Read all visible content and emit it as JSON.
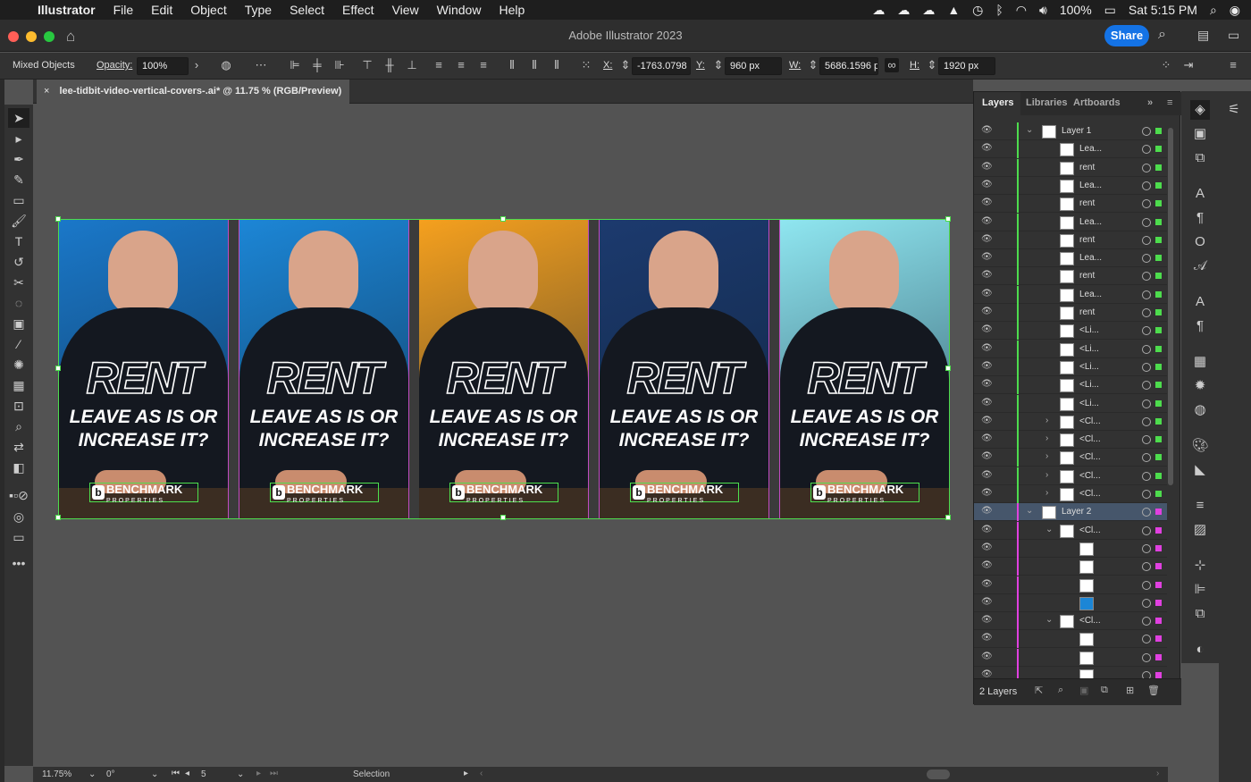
{
  "menubar": {
    "app": "Illustrator",
    "items": [
      "File",
      "Edit",
      "Object",
      "Type",
      "Select",
      "Effect",
      "View",
      "Window",
      "Help"
    ],
    "battery": "100%",
    "clock": "Sat 5:15 PM"
  },
  "window": {
    "title": "Adobe Illustrator 2023",
    "share_label": "Share"
  },
  "control_bar": {
    "selection_type": "Mixed Objects",
    "opacity_label": "Opacity:",
    "opacity_value": "100%",
    "x_label": "X:",
    "x_value": "-1763.0798",
    "y_label": "Y:",
    "y_value": "960 px",
    "w_label": "W:",
    "w_value": "5686.1596 p",
    "h_label": "H:",
    "h_value": "1920 px"
  },
  "document_tab": {
    "label": "lee-tidbit-video-vertical-covers-.ai* @ 11.75 % (RGB/Preview)",
    "close": "×"
  },
  "artboards": {
    "headline": "RENT",
    "subline_1": "LEAVE AS IS OR",
    "subline_2": "INCREASE IT?",
    "brand": "BENCHMARK",
    "brand_sub": "PROPERTIES",
    "brand_mark": "b",
    "backgrounds": [
      "#1a78c9",
      "#1c86d6",
      "#f5a01e",
      "#1c3a6e",
      "#8fe6f0"
    ]
  },
  "layers_panel": {
    "tabs": [
      "Layers",
      "Libraries",
      "Artboards"
    ],
    "rows": [
      {
        "name": "Layer 1",
        "indent": 0,
        "chev": "v",
        "color": "#4ddc4d",
        "layer": true
      },
      {
        "name": "Lea...",
        "indent": 1,
        "chev": "",
        "color": "#4ddc4d"
      },
      {
        "name": "rent",
        "indent": 1,
        "chev": "",
        "color": "#4ddc4d"
      },
      {
        "name": "Lea...",
        "indent": 1,
        "chev": "",
        "color": "#4ddc4d"
      },
      {
        "name": "rent",
        "indent": 1,
        "chev": "",
        "color": "#4ddc4d"
      },
      {
        "name": "Lea...",
        "indent": 1,
        "chev": "",
        "color": "#4ddc4d"
      },
      {
        "name": "rent",
        "indent": 1,
        "chev": "",
        "color": "#4ddc4d"
      },
      {
        "name": "Lea...",
        "indent": 1,
        "chev": "",
        "color": "#4ddc4d"
      },
      {
        "name": "rent",
        "indent": 1,
        "chev": "",
        "color": "#4ddc4d"
      },
      {
        "name": "Lea...",
        "indent": 1,
        "chev": "",
        "color": "#4ddc4d"
      },
      {
        "name": "rent",
        "indent": 1,
        "chev": "",
        "color": "#4ddc4d"
      },
      {
        "name": "<Li...",
        "indent": 1,
        "chev": "",
        "color": "#4ddc4d"
      },
      {
        "name": "<Li...",
        "indent": 1,
        "chev": "",
        "color": "#4ddc4d"
      },
      {
        "name": "<Li...",
        "indent": 1,
        "chev": "",
        "color": "#4ddc4d"
      },
      {
        "name": "<Li...",
        "indent": 1,
        "chev": "",
        "color": "#4ddc4d"
      },
      {
        "name": "<Li...",
        "indent": 1,
        "chev": "",
        "color": "#4ddc4d"
      },
      {
        "name": "<Cl...",
        "indent": 1,
        "chev": ">",
        "color": "#4ddc4d"
      },
      {
        "name": "<Cl...",
        "indent": 1,
        "chev": ">",
        "color": "#4ddc4d"
      },
      {
        "name": "<Cl...",
        "indent": 1,
        "chev": ">",
        "color": "#4ddc4d"
      },
      {
        "name": "<Cl...",
        "indent": 1,
        "chev": ">",
        "color": "#4ddc4d"
      },
      {
        "name": "<Cl...",
        "indent": 1,
        "chev": ">",
        "color": "#4ddc4d"
      },
      {
        "name": "Layer 2",
        "indent": 0,
        "chev": "v",
        "color": "#e040e0",
        "layer": true,
        "selected": true
      },
      {
        "name": "<Cl...",
        "indent": 2,
        "chev": "v",
        "color": "#e040e0"
      },
      {
        "name": "",
        "indent": 3,
        "chev": "",
        "color": "#e040e0"
      },
      {
        "name": "",
        "indent": 3,
        "chev": "",
        "color": "#e040e0"
      },
      {
        "name": "",
        "indent": 3,
        "chev": "",
        "color": "#e040e0"
      },
      {
        "name": "",
        "indent": 3,
        "chev": "",
        "color": "#e040e0",
        "thumbcolor": "#1c86d6"
      },
      {
        "name": "<Cl...",
        "indent": 2,
        "chev": "v",
        "color": "#e040e0"
      },
      {
        "name": "",
        "indent": 3,
        "chev": "",
        "color": "#e040e0"
      },
      {
        "name": "",
        "indent": 3,
        "chev": "",
        "color": "#e040e0"
      },
      {
        "name": "",
        "indent": 3,
        "chev": "",
        "color": "#e040e0"
      }
    ],
    "footer_count": "2 Layers"
  },
  "status_bar": {
    "zoom": "11.75%",
    "rotation": "0°",
    "artboard_num": "5",
    "tool": "Selection"
  },
  "colors": {
    "selection_green": "#4ddc4d",
    "layer2_magenta": "#e040e0",
    "accent_blue": "#1473e6"
  }
}
